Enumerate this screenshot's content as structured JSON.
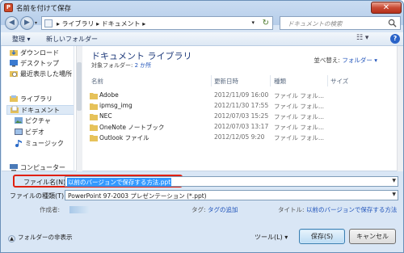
{
  "window": {
    "title": "名前を付けて保存",
    "close_label": "✕"
  },
  "nav": {
    "back_label": "◀",
    "forward_label": "▶",
    "breadcrumb": "▸ ライブラリ ▸ ドキュメント ▸",
    "refresh_label": "↻",
    "search_placeholder": "ドキュメントの検索"
  },
  "toolbar": {
    "organize": "整理 ▾",
    "new_folder": "新しいフォルダー",
    "view_label": "☷ ▾",
    "help_label": "?"
  },
  "sidebar": {
    "items": [
      {
        "label": "ダウンロード",
        "icon": "download-folder-icon"
      },
      {
        "label": "デスクトップ",
        "icon": "desktop-icon"
      },
      {
        "label": "最近表示した場所",
        "icon": "recent-places-icon"
      },
      {
        "label": "ライブラリ",
        "icon": "library-icon"
      },
      {
        "label": "ドキュメント",
        "icon": "documents-icon"
      },
      {
        "label": "ピクチャ",
        "icon": "pictures-icon"
      },
      {
        "label": "ビデオ",
        "icon": "video-icon"
      },
      {
        "label": "ミュージック",
        "icon": "music-icon"
      },
      {
        "label": "コンピューター",
        "icon": "computer-icon"
      }
    ]
  },
  "library": {
    "title": "ドキュメント ライブラリ",
    "subtitle_prefix": "対象フォルダー:",
    "subtitle_link": "2 か所",
    "sort_label": "並べ替え:",
    "sort_value": "フォルダー ▾"
  },
  "columns": {
    "name": "名前",
    "date": "更新日時",
    "type": "種類",
    "size": "サイズ"
  },
  "files": [
    {
      "name": "Adobe",
      "date": "2012/11/09 16:00",
      "type": "ファイル フォル..."
    },
    {
      "name": "ipmsg_img",
      "date": "2012/11/30 17:55",
      "type": "ファイル フォル..."
    },
    {
      "name": "NEC",
      "date": "2012/07/03 15:25",
      "type": "ファイル フォル..."
    },
    {
      "name": "OneNote ノートブック",
      "date": "2012/07/03 13:17",
      "type": "ファイル フォル..."
    },
    {
      "name": "Outlook ファイル",
      "date": "2012/12/05 9:20",
      "type": "ファイル フォル..."
    }
  ],
  "fields": {
    "filename_label": "ファイル名(N):",
    "filename_value": "以前のバージョンで保存する方法.ppt",
    "filetype_label": "ファイルの種類(T):",
    "filetype_value": "PowerPoint 97-2003 プレゼンテーション (*.ppt)",
    "author_label": "作成者:",
    "tag_label": "タグ:",
    "tag_value": "タグの追加",
    "title_label": "タイトル:",
    "title_value": "以前のバージョンで保存する方法"
  },
  "footer": {
    "hide_folders": "フォルダーの非表示",
    "tools": "ツール(L) ▾",
    "save": "保存(S)",
    "cancel": "キャンセル"
  }
}
